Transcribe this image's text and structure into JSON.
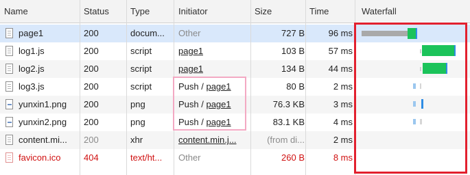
{
  "columns": {
    "name": "Name",
    "status": "Status",
    "type": "Type",
    "initiator": "Initiator",
    "size": "Size",
    "time": "Time",
    "waterfall": "Waterfall"
  },
  "rows": [
    {
      "name": "page1",
      "status": "200",
      "type": "docum...",
      "initiator": "Other",
      "size": "727 B",
      "time": "96 ms"
    },
    {
      "name": "log1.js",
      "status": "200",
      "type": "script",
      "initiator": "page1",
      "size": "103 B",
      "time": "57 ms"
    },
    {
      "name": "log2.js",
      "status": "200",
      "type": "script",
      "initiator": "page1",
      "size": "134 B",
      "time": "44 ms"
    },
    {
      "name": "log3.js",
      "status": "200",
      "type": "script",
      "initiator_prefix": "Push / ",
      "initiator": "page1",
      "size": "80 B",
      "time": "2 ms"
    },
    {
      "name": "yunxin1.png",
      "status": "200",
      "type": "png",
      "initiator_prefix": "Push / ",
      "initiator": "page1",
      "size": "76.3 KB",
      "time": "3 ms"
    },
    {
      "name": "yunxin2.png",
      "status": "200",
      "type": "png",
      "initiator_prefix": "Push / ",
      "initiator": "page1",
      "size": "83.1 KB",
      "time": "4 ms"
    },
    {
      "name": "content.mi...",
      "status": "200",
      "type": "xhr",
      "initiator": "content.min.j...",
      "size": "(from di...",
      "time": "2 ms"
    },
    {
      "name": "favicon.ico",
      "status": "404",
      "type": "text/ht...",
      "initiator": "Other",
      "size": "260 B",
      "time": "8 ms"
    }
  ],
  "colors": {
    "waiting": "#a9a9a9",
    "download": "#1bc35a",
    "receive_edge": "#2f8de4",
    "error_text": "#d01010",
    "highlight_initiator": "#f3a9c3",
    "highlight_waterfall": "#e2202e"
  }
}
